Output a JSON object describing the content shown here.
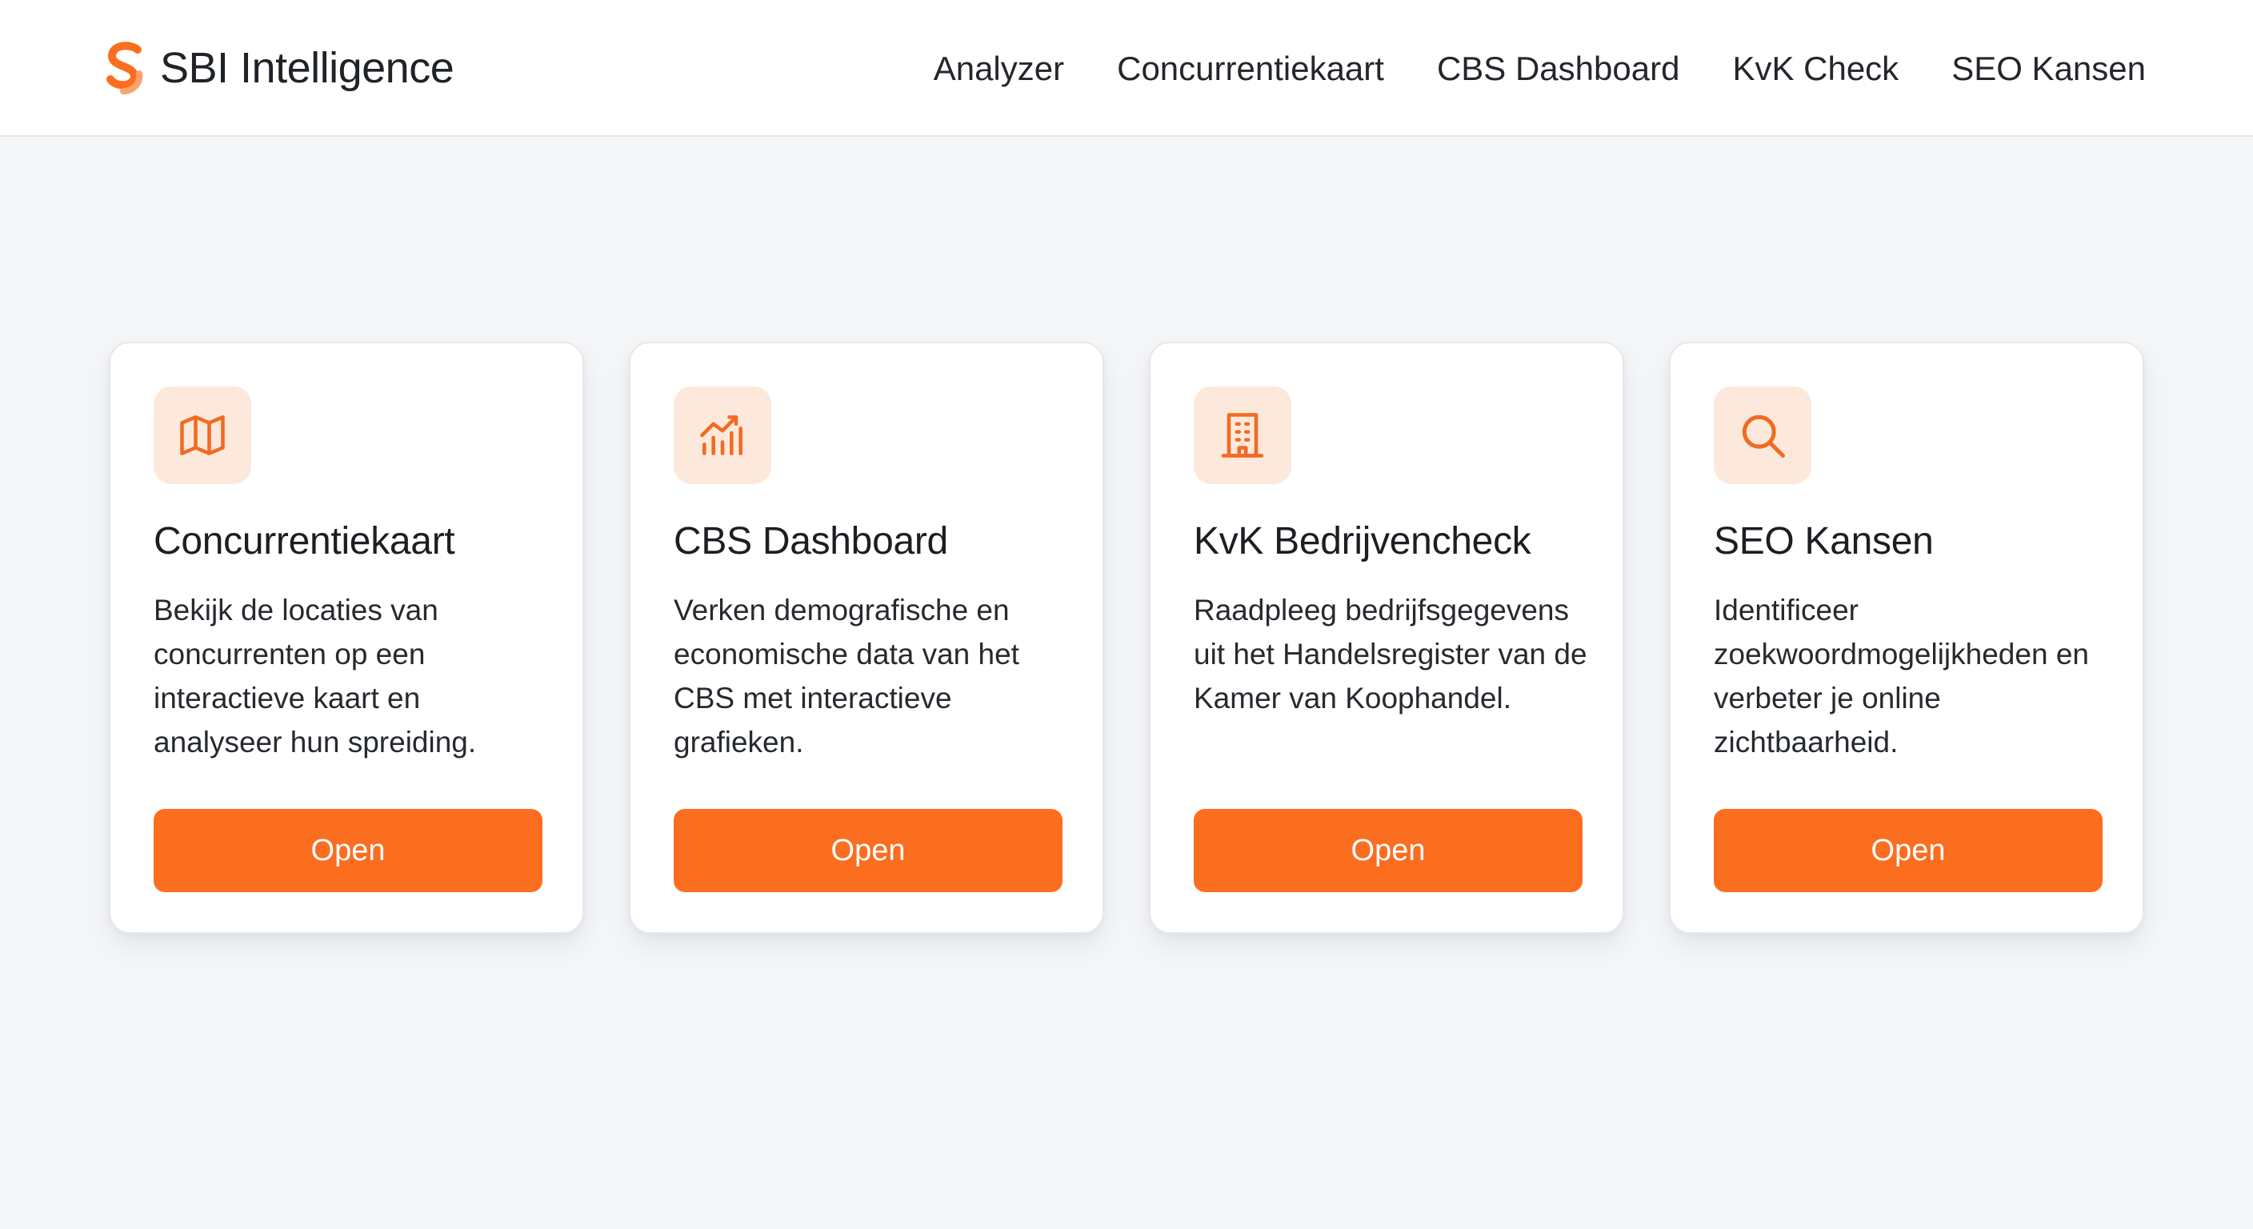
{
  "header": {
    "brand_name": "SBI Intelligence",
    "logo_icon": "s-logo-icon",
    "nav": [
      {
        "label": "Analyzer"
      },
      {
        "label": "Concurrentiekaart"
      },
      {
        "label": "CBS Dashboard"
      },
      {
        "label": "KvK Check"
      },
      {
        "label": "SEO Kansen"
      }
    ]
  },
  "colors": {
    "accent": "#fb6d1f",
    "icon_bg": "#fde9dc",
    "page_bg": "#f4f6f8"
  },
  "cards": [
    {
      "icon": "map-icon",
      "title": "Concurrentiekaart",
      "description": "Bekijk de locaties van concurrenten op een interactieve kaart en analyseer hun spreiding.",
      "button_label": "Open"
    },
    {
      "icon": "chart-icon",
      "title": "CBS Dashboard",
      "description": "Verken demografische en economische data van het CBS met interactieve grafieken.",
      "button_label": "Open"
    },
    {
      "icon": "building-icon",
      "title": "KvK Bedrijvencheck",
      "description": "Raadpleeg bedrijfsgegevens uit het Handelsregister van de Kamer van Koophandel.",
      "button_label": "Open"
    },
    {
      "icon": "search-icon",
      "title": "SEO Kansen",
      "description": "Identificeer zoekwoordmogelijkheden en verbeter je online zichtbaarheid.",
      "button_label": "Open"
    }
  ]
}
